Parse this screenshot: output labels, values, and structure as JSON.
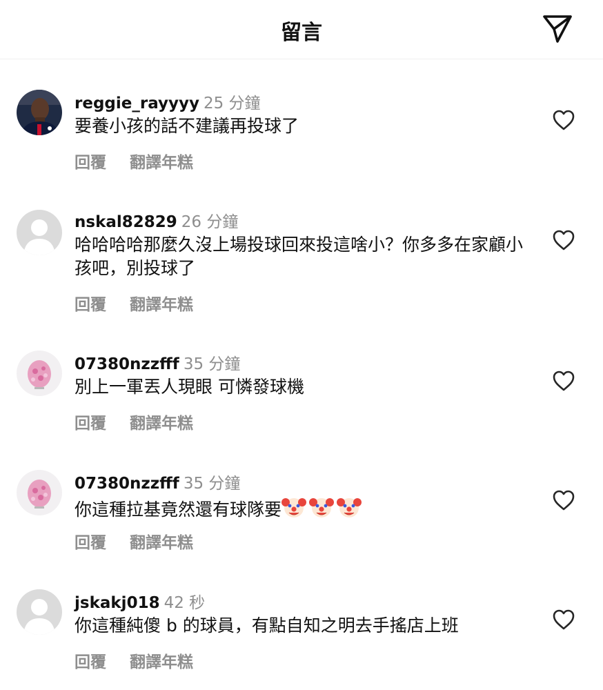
{
  "header": {
    "title": "留言"
  },
  "actions": {
    "reply": "回覆",
    "translate": "翻譯年糕"
  },
  "comments": [
    {
      "username": "reggie_rayyyy",
      "time": "25 分鐘",
      "text": "要養小孩的話不建議再投球了",
      "avatar": "player-photo"
    },
    {
      "username": "nskal82829",
      "time": "26 分鐘",
      "text": "哈哈哈哈那麼久沒上場投球回來投這啥小？你多多在家顧小孩吧，別投球了",
      "avatar": "default-person"
    },
    {
      "username": "07380nzzfff",
      "time": "35 分鐘",
      "text": "別上一軍丟人現眼 可憐發球機",
      "avatar": "pink-ape"
    },
    {
      "username": "07380nzzfff",
      "time": "35 分鐘",
      "text": "你這種拉基竟然還有球隊要",
      "emoji": [
        "clown-face",
        "clown-face",
        "clown-face"
      ],
      "avatar": "pink-ape"
    },
    {
      "username": "jskakj018",
      "time": "42 秒",
      "text": "你這種純傻 b 的球員，有點自知之明去手搖店上班",
      "avatar": "default-person"
    }
  ]
}
